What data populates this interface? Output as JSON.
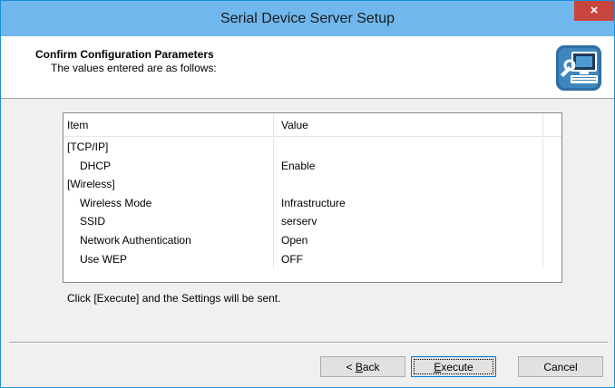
{
  "window": {
    "title": "Serial Device Server Setup",
    "close_symbol": "×"
  },
  "header": {
    "title": "Confirm Configuration Parameters",
    "subtitle": "The values entered are as follows:",
    "icon": "computer-settings-icon"
  },
  "table": {
    "columns": [
      "Item",
      "Value"
    ],
    "rows": [
      {
        "item": "[TCP/IP]",
        "value": ""
      },
      {
        "item": "DHCP",
        "value": "Enable"
      },
      {
        "item": "[Wireless]",
        "value": ""
      },
      {
        "item": "Wireless Mode",
        "value": "Infrastructure"
      },
      {
        "item": "SSID",
        "value": "serserv"
      },
      {
        "item": "Network Authentication",
        "value": "Open"
      },
      {
        "item": "Use WEP",
        "value": "OFF"
      }
    ]
  },
  "info_text": "Click [Execute] and the Settings will be sent.",
  "buttons": {
    "back_prefix": "< ",
    "back_accel": "B",
    "back_rest": "ack",
    "execute_accel": "E",
    "execute_rest": "xecute",
    "cancel": "Cancel"
  },
  "colors": {
    "titlebar": "#6fb7ec",
    "close": "#c7453c",
    "accent": "#0078d7"
  }
}
